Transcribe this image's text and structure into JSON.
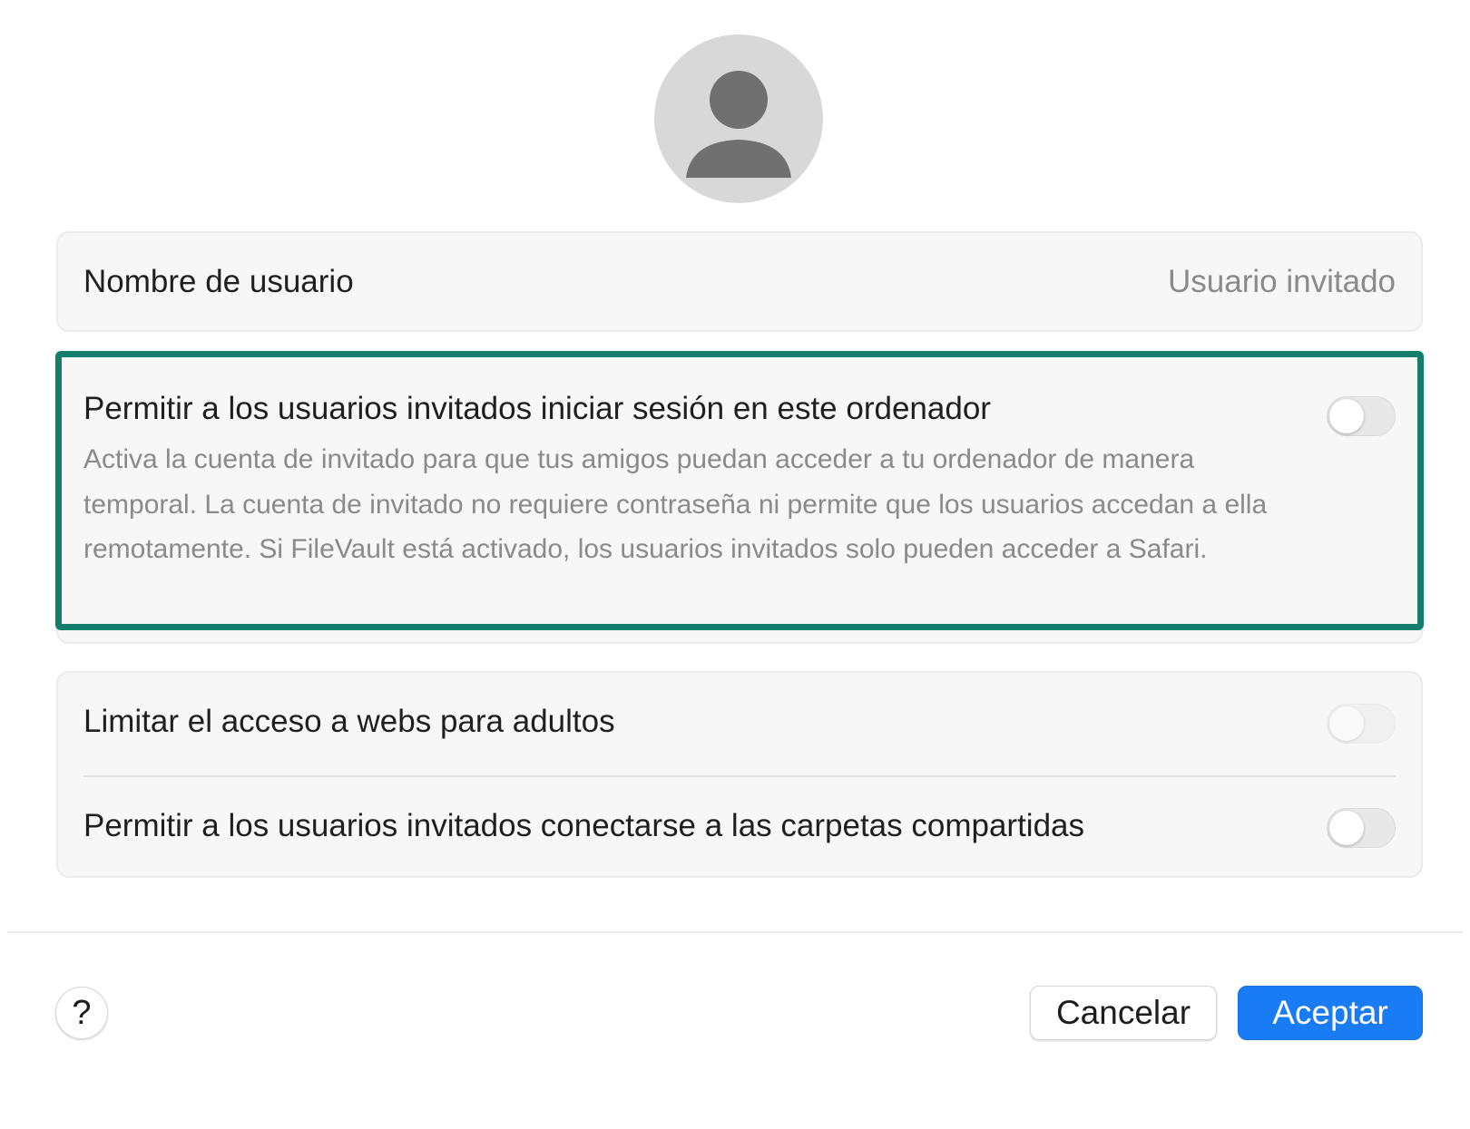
{
  "avatar": {
    "icon": "user-silhouette-icon"
  },
  "username_row": {
    "label": "Nombre de usuario",
    "value": "Usuario invitado"
  },
  "guest_login": {
    "label": "Permitir a los usuarios invitados iniciar sesión en este ordenador",
    "description": "Activa la cuenta de invitado para que tus amigos puedan acceder a tu ordenador de manera temporal. La cuenta de invitado no requiere contraseña ni permite que los usuarios accedan a ella remotamente. Si FileVault está activado, los usuarios invitados solo pueden acceder a Safari.",
    "enabled": false
  },
  "restrictions": {
    "adult_sites": {
      "label": "Limitar el acceso a webs para adultos",
      "enabled": false,
      "disabled": true
    },
    "shared_folders": {
      "label": "Permitir a los usuarios invitados conectarse a las carpetas compartidas",
      "enabled": false
    }
  },
  "footer": {
    "help_label": "?",
    "cancel_label": "Cancelar",
    "accept_label": "Aceptar"
  },
  "colors": {
    "accent": "#1a7cf5",
    "highlight_border": "#147d6b",
    "card_background": "#f7f7f7"
  }
}
